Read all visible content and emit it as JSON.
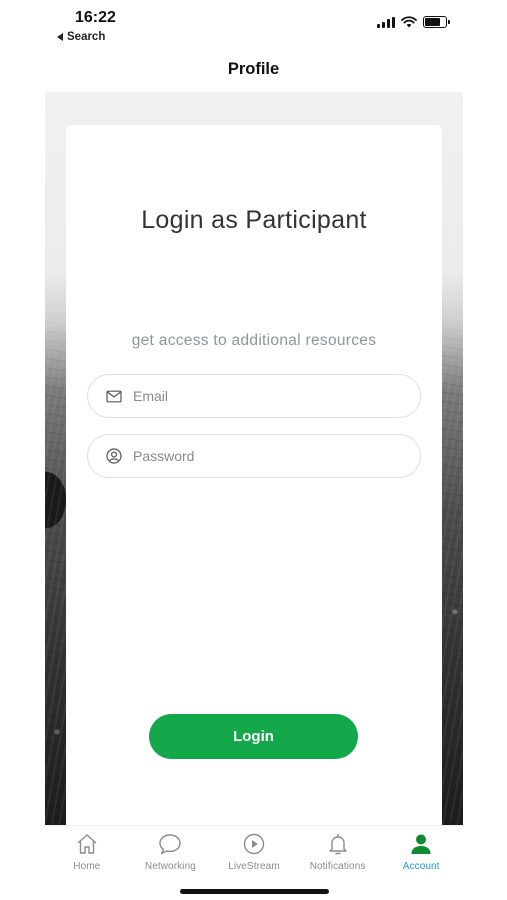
{
  "status_bar": {
    "time": "16:22",
    "back_label": "Search",
    "icons": [
      "signal-icon",
      "wifi-icon",
      "battery-icon"
    ]
  },
  "header": {
    "title": "Profile"
  },
  "login_card": {
    "title": "Login as Participant",
    "subtitle": "get access to additional resources",
    "email_field": {
      "placeholder": "Email",
      "value": "",
      "icon": "mail-icon"
    },
    "password_field": {
      "placeholder": "Password",
      "value": "",
      "icon": "user-circle-icon"
    },
    "login_button": "Login"
  },
  "tab_bar": {
    "items": [
      {
        "label": "Home",
        "icon": "home-icon",
        "active": false
      },
      {
        "label": "Networking",
        "icon": "chat-bubble-icon",
        "active": false
      },
      {
        "label": "LiveStream",
        "icon": "play-circle-icon",
        "active": false
      },
      {
        "label": "Notifications",
        "icon": "bell-icon",
        "active": false
      },
      {
        "label": "Account",
        "icon": "person-icon",
        "active": true
      }
    ]
  },
  "colors": {
    "primary_button": "#12a84a",
    "active_tab_icon": "#0f8a2e",
    "active_tab_label": "#1a9bd7",
    "inactive_tab": "#8c8c8c"
  }
}
